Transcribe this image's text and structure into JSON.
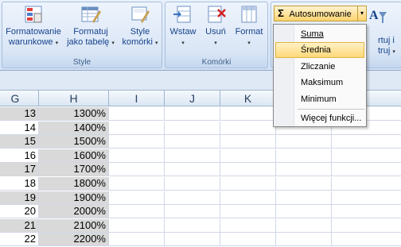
{
  "ribbon": {
    "style_group": {
      "label": "Style",
      "buttons": [
        {
          "line1": "Formatowanie",
          "line2": "warunkowe"
        },
        {
          "line1": "Formatuj",
          "line2": "jako tabelę"
        },
        {
          "line1": "Style",
          "line2": "komórki"
        }
      ]
    },
    "cells_group": {
      "label": "Komórki",
      "buttons": [
        {
          "line1": "Wstaw"
        },
        {
          "line1": "Usuń"
        },
        {
          "line1": "Format"
        }
      ]
    },
    "autosum": {
      "symbol": "Σ",
      "label": "Autosumowanie"
    },
    "partial_right": {
      "line1": "rtuj i",
      "line2": "truj"
    }
  },
  "dropdown": {
    "items": [
      {
        "label": "Suma",
        "highlighted": false
      },
      {
        "label": "Średnia",
        "highlighted": true
      },
      {
        "label": "Zliczanie",
        "highlighted": false
      },
      {
        "label": "Maksimum",
        "highlighted": false
      },
      {
        "label": "Minimum",
        "highlighted": false
      },
      {
        "label": "Więcej funkcji...",
        "highlighted": false
      }
    ]
  },
  "sheet": {
    "columns": [
      "G",
      "H",
      "I",
      "J",
      "K"
    ],
    "rows": [
      {
        "g": "13",
        "h": "1300%"
      },
      {
        "g": "14",
        "h": "1400%"
      },
      {
        "g": "15",
        "h": "1500%"
      },
      {
        "g": "16",
        "h": "1600%"
      },
      {
        "g": "17",
        "h": "1700%"
      },
      {
        "g": "18",
        "h": "1800%"
      },
      {
        "g": "19",
        "h": "1900%"
      },
      {
        "g": "20",
        "h": "2000%"
      },
      {
        "g": "21",
        "h": "2100%"
      },
      {
        "g": "22",
        "h": "2200%"
      }
    ]
  },
  "colors": {
    "selection": "#d9d9d9",
    "menu_highlight": "#ffd87a",
    "ribbon_text": "#15428b"
  }
}
